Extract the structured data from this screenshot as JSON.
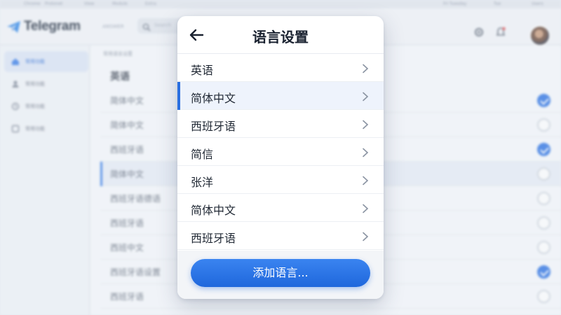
{
  "app": {
    "brand": "Telegram",
    "menubar": [
      "Chrome",
      "Protonet",
      "View",
      "Module",
      "Extra"
    ],
    "menubar_right": [
      "Fri Tuesday",
      "Tue",
      "Users"
    ],
    "top_label": "ANSWER",
    "search_placeholder": "Search",
    "sidebar": [
      {
        "label": "常用功能",
        "icon": "home-icon",
        "active": true
      },
      {
        "label": "常用功能",
        "icon": "user-icon",
        "active": false
      },
      {
        "label": "常用功能",
        "icon": "clock-icon",
        "active": false
      },
      {
        "label": "常用功能",
        "icon": "square-icon",
        "active": false
      }
    ],
    "breadcrumb": "常用语言设置",
    "list_heading": "英语",
    "rows": [
      {
        "label": "简体中文",
        "checked": true,
        "highlight": false
      },
      {
        "label": "简体中文",
        "checked": false,
        "highlight": false
      },
      {
        "label": "西班牙语",
        "checked": true,
        "highlight": false
      },
      {
        "label": "简体中文",
        "checked": false,
        "highlight": true
      },
      {
        "label": "西班牙语德语",
        "checked": false,
        "highlight": false
      },
      {
        "label": "西班牙语",
        "checked": false,
        "highlight": false
      },
      {
        "label": "西班中文",
        "checked": false,
        "highlight": false
      },
      {
        "label": "西班牙语设置",
        "checked": true,
        "highlight": false
      },
      {
        "label": "西班牙语",
        "checked": false,
        "highlight": false
      }
    ]
  },
  "modal": {
    "title": "语言设置",
    "back_icon": "arrow-left-icon",
    "items": [
      {
        "label": "英语",
        "selected": false
      },
      {
        "label": "简体中文",
        "selected": true
      },
      {
        "label": "西班牙语",
        "selected": false
      },
      {
        "label": "简信",
        "selected": false
      },
      {
        "label": "张洋",
        "selected": false
      },
      {
        "label": "简体中文",
        "selected": false
      },
      {
        "label": "西班牙语",
        "selected": false
      }
    ],
    "add_button_label": "添加语言..."
  },
  "colors": {
    "accent": "#2a6fe0",
    "check_on": "#2f74e4",
    "modal_bg": "#ffffff",
    "title_text": "#1a2230"
  }
}
